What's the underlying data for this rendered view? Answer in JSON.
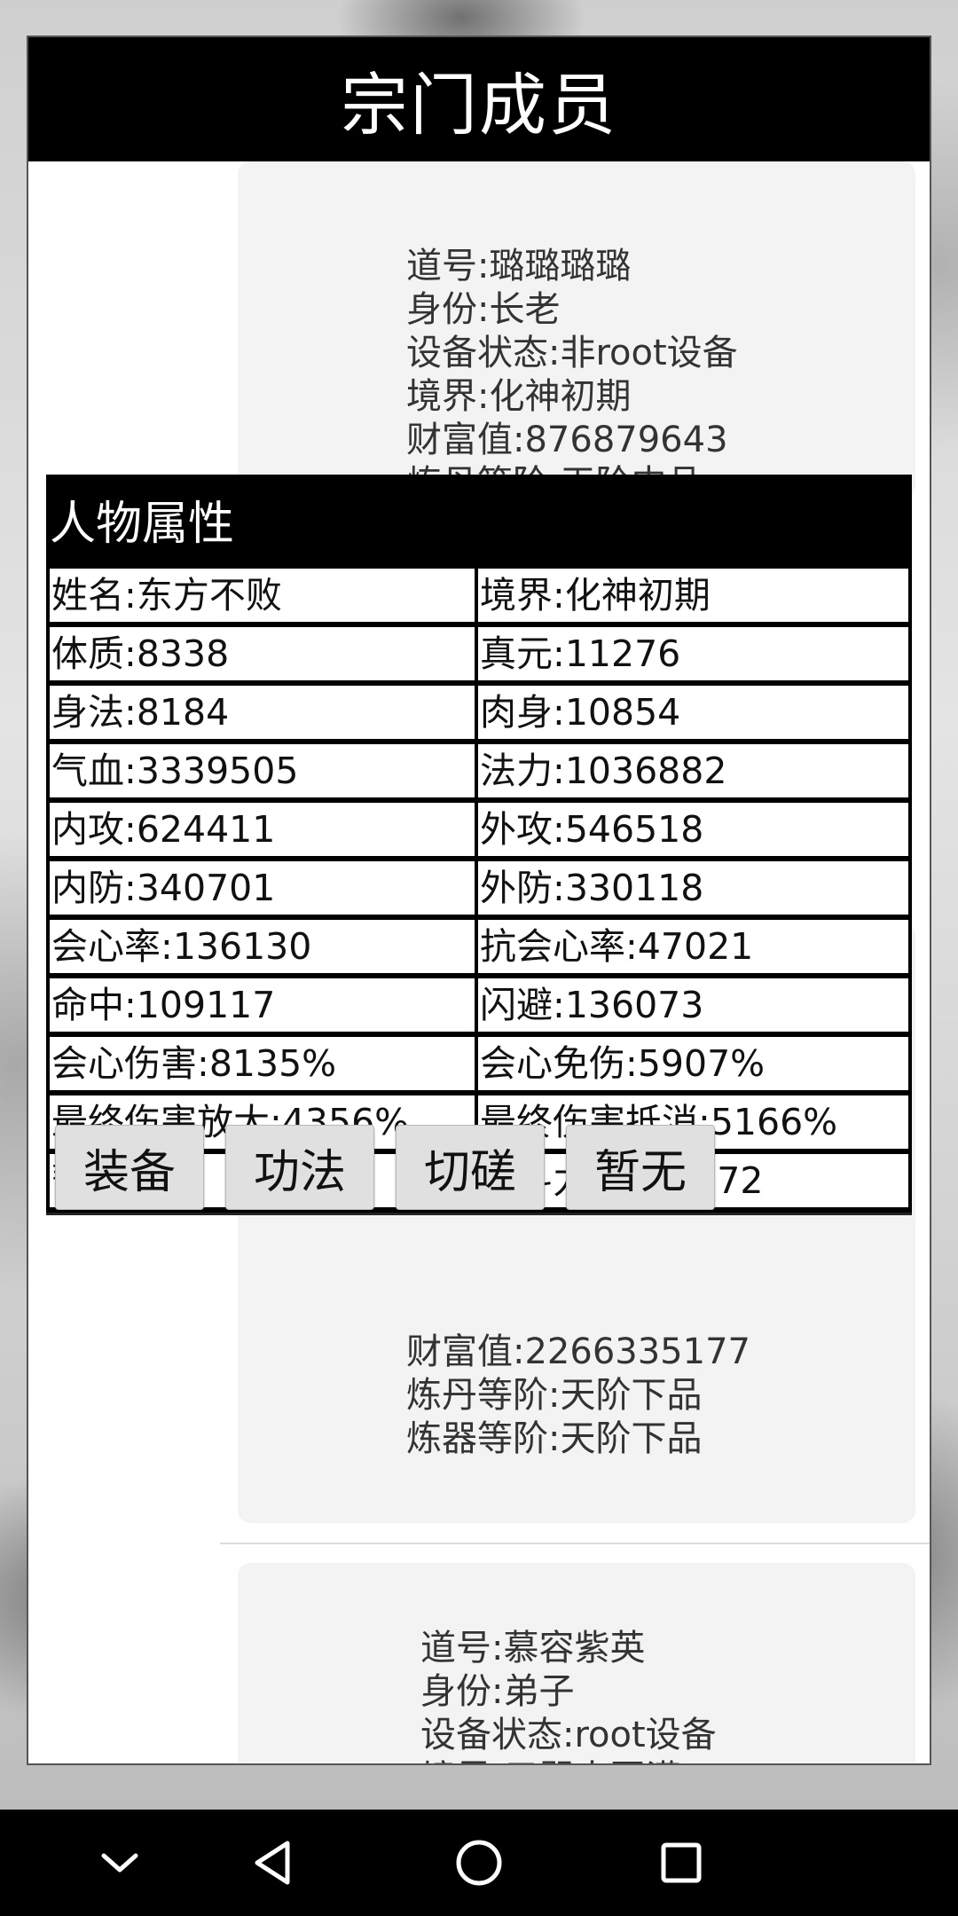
{
  "panel": {
    "title": "宗门成员"
  },
  "members": [
    {
      "lines": [
        "道号:璐璐璐璐",
        "身份:长老",
        "设备状态:非root设备",
        "境界:化神初期",
        "财富值:876879643",
        "炼丹等阶:天阶中品"
      ]
    },
    {
      "lines": [
        "财富值:2266335177",
        "炼丹等阶:天阶下品",
        "炼器等阶:天阶下品"
      ]
    },
    {
      "lines": [
        "道号:慕容紫英",
        "身份:弟子",
        "设备状态:root设备",
        "境界:元婴大圆满"
      ]
    }
  ],
  "attributes": {
    "title": "人物属性",
    "rows": [
      [
        "姓名:东方不败",
        "境界:化神初期"
      ],
      [
        "体质:8338",
        "真元:11276"
      ],
      [
        "身法:8184",
        "肉身:10854"
      ],
      [
        "气血:3339505",
        "法力:1036882"
      ],
      [
        "内攻:624411",
        "外攻:546518"
      ],
      [
        "内防:340701",
        "外防:330118"
      ],
      [
        "会心率:136130",
        "抗会心率:47021"
      ],
      [
        "命中:109117",
        "闪避:136073"
      ],
      [
        "会心伤害:8135%",
        "会心免伤:5907%"
      ],
      [
        "最终伤害放大:4356%",
        "最终伤害抵消:5166%"
      ],
      [
        "暂无",
        "战斗力:6336272"
      ]
    ],
    "buttons": [
      "装备",
      "功法",
      "切磋",
      "暂无"
    ]
  },
  "navbar": {
    "icons": [
      "chevron-down-icon",
      "back-triangle-icon",
      "home-circle-icon",
      "recents-square-icon"
    ]
  }
}
